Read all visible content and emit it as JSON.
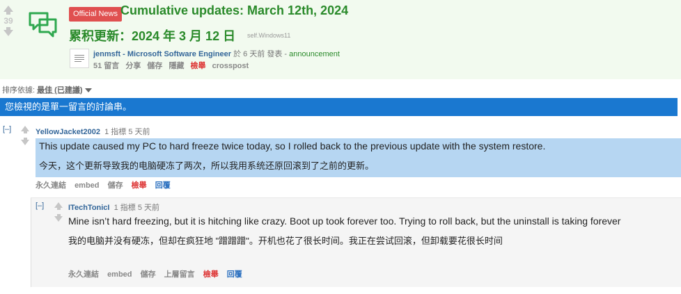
{
  "post": {
    "score": "39",
    "flair": "Official News",
    "title_en": "Cumulative updates: March 12th, 2024",
    "title_zh": "累积更新：2024 年 3 月 12 日",
    "domain": "self.Windows11",
    "author": "jenmsft - Microsoft Software Engineer",
    "time_text": "於 6 天前 發表 -",
    "flair_tag": "announcement",
    "buttons": [
      "51 留言",
      "分享",
      "儲存",
      "隱藏",
      "檢舉",
      "crosspost"
    ]
  },
  "sort": {
    "label": "排序依據:",
    "value": "最佳 (已建議)"
  },
  "banner": "您檢視的是單一留言的討論串。",
  "comments": [
    {
      "expand": "[–]",
      "author": "YellowJacket2002",
      "points": "1 指標",
      "time": "5 天前",
      "body_en": "This update caused my PC to hard freeze twice today, so I rolled back to the previous update with the system restore.",
      "body_zh": "今天，这个更新导致我的电脑硬冻了两次，所以我用系统还原回滚到了之前的更新。",
      "buttons": [
        "永久連結",
        "embed",
        "儲存",
        "檢舉",
        "回覆"
      ]
    },
    {
      "expand": "[–]",
      "author": "ITechTonicI",
      "points": "1 指標",
      "time": "5 天前",
      "body_en": "Mine isn’t hard freezing, but it is hitching like crazy. Boot up took forever too. Trying to roll back, but the uninstall is taking forever",
      "body_zh": "我的电脑并没有硬冻，但却在疯狂地 \"蹭蹭蹭\"。开机也花了很长时间。我正在尝试回滚，但卸载要花很长时间",
      "buttons": [
        "永久連結",
        "embed",
        "儲存",
        "上層留言",
        "檢舉",
        "回覆"
      ]
    }
  ],
  "colors": {
    "title_green": "#2a8a2a",
    "flair_red": "#e05050",
    "banner_blue": "#1a78d0",
    "highlight": "#b6d6f2"
  }
}
